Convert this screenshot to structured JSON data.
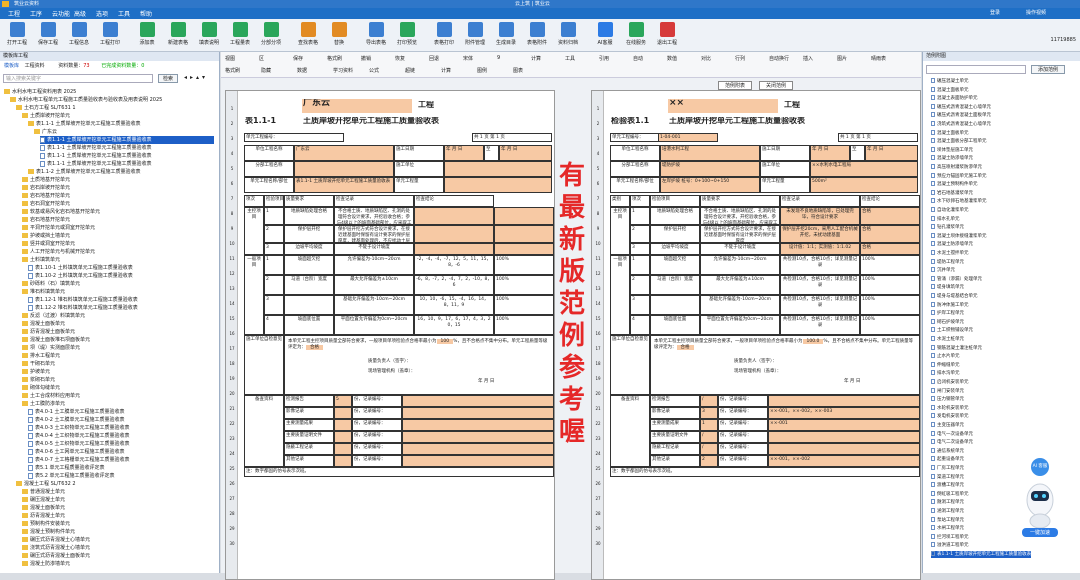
{
  "app": {
    "title": "筑业云资料",
    "center_title": "云上筑 | 筑业云",
    "menu": [
      "工程",
      "工序",
      "云功能",
      "高级",
      "选项",
      "工具",
      "帮助"
    ],
    "right_menu": [
      "登录",
      "操作视频"
    ]
  },
  "toolbar": {
    "buttons": [
      "打开工程",
      "保存工程",
      "工程信息",
      "工程打印",
      "添加表",
      "新建表格",
      "填表说明",
      "工程量表",
      "分部分项",
      "查找表格",
      "替换",
      "导出表格",
      "打印预览",
      "表格打印",
      "附件管理",
      "生成目录",
      "表格附件",
      "资料归档",
      "AI客服",
      "在线服务",
      "退出工程"
    ],
    "right_text": "11719885"
  },
  "left_panel": {
    "header": "模板库工程",
    "tabs": [
      "模板库",
      "工程资料"
    ],
    "count_label": "资料数量：",
    "count": "73",
    "done_label": "已完成资料数量：",
    "done": "0",
    "search_placeholder": "输入搜索关键字",
    "search_button": "检索",
    "tree": [
      {
        "t": "水利水电工程资料用表 2025",
        "d": 0,
        "f": "folder"
      },
      {
        "t": "水利水电工程单元工程施工质量验收表与验收表及用表说明 2025",
        "d": 1,
        "f": "folder"
      },
      {
        "t": "土石方工程 SL/T631 1",
        "d": 2,
        "f": "folder"
      },
      {
        "t": "土质岸坡开挖单元",
        "d": 3,
        "f": "folder"
      },
      {
        "t": "表1.1-1 土质岸坡开挖单元工程施工质量验收表",
        "d": 4,
        "f": "folder"
      },
      {
        "t": "广东云",
        "d": 5,
        "f": "folder"
      },
      {
        "t": "表1.1-1 土质岸坡开挖单元工程施工质量验收表",
        "d": 6,
        "f": "doc",
        "sel": true
      },
      {
        "t": "表1.1-1 土质岸坡开挖单元工程施工质量验收表",
        "d": 6,
        "f": "doc"
      },
      {
        "t": "表1.1-1 土质岸坡开挖单元工程施工质量验收表",
        "d": 6,
        "f": "doc"
      },
      {
        "t": "表1.1-1 土质岸坡开挖单元工程施工质量验收表",
        "d": 6,
        "f": "doc"
      },
      {
        "t": "表1.1-2 土质岸坡开挖单元工程施工质量验收表",
        "d": 4,
        "f": "folder"
      },
      {
        "t": "土质地基开挖单元",
        "d": 3,
        "f": "folder"
      },
      {
        "t": "岩石岸坡开挖单元",
        "d": 3,
        "f": "folder"
      },
      {
        "t": "岩石地基开挖单元",
        "d": 3,
        "f": "folder"
      },
      {
        "t": "岩石洞室开挖单元",
        "d": 3,
        "f": "folder"
      },
      {
        "t": "软基或易风化岩石地基开挖单元",
        "d": 3,
        "f": "folder"
      },
      {
        "t": "岩石地基开挖单元",
        "d": 3,
        "f": "folder"
      },
      {
        "t": "平洞开挖单元或洞室开挖单元",
        "d": 3,
        "f": "folder"
      },
      {
        "t": "护坡或挡土墙单元",
        "d": 3,
        "f": "folder"
      },
      {
        "t": "竖井或洞室开挖单元",
        "d": 3,
        "f": "folder"
      },
      {
        "t": "人工开挖单元与机械开挖单元",
        "d": 3,
        "f": "folder"
      },
      {
        "t": "土料填筑单元",
        "d": 3,
        "f": "folder"
      },
      {
        "t": "表1.10-1 土料填筑单元工程施工质量验收表",
        "d": 4,
        "f": "doc"
      },
      {
        "t": "表1.10-2 土料填筑单元工程施工质量验收表",
        "d": 4,
        "f": "doc"
      },
      {
        "t": "砂砾料（石）填筑单元",
        "d": 3,
        "f": "folder"
      },
      {
        "t": "堆石料填筑单元",
        "d": 3,
        "f": "folder"
      },
      {
        "t": "表1.12-1 堆石料填筑单元工程施工质量验收表",
        "d": 4,
        "f": "doc"
      },
      {
        "t": "表1.12-2 堆石料填筑单元工程施工质量验收表",
        "d": 4,
        "f": "doc"
      },
      {
        "t": "反滤（过渡）料填筑单元",
        "d": 3,
        "f": "folder"
      },
      {
        "t": "混凝土面板单元",
        "d": 3,
        "f": "folder"
      },
      {
        "t": "沥青混凝土面板单元",
        "d": 3,
        "f": "folder"
      },
      {
        "t": "混凝土面板堆石坝面板单元",
        "d": 3,
        "f": "folder"
      },
      {
        "t": "坝（堤）实测面层单元",
        "d": 3,
        "f": "folder"
      },
      {
        "t": "排水工程单元",
        "d": 3,
        "f": "folder"
      },
      {
        "t": "干砌石单元",
        "d": 3,
        "f": "folder"
      },
      {
        "t": "护坡单元",
        "d": 3,
        "f": "folder"
      },
      {
        "t": "浆砌石单元",
        "d": 3,
        "f": "folder"
      },
      {
        "t": "砌体勾缝单元",
        "d": 3,
        "f": "folder"
      },
      {
        "t": "土工合成材料应用单元",
        "d": 3,
        "f": "folder"
      },
      {
        "t": "土工膜防渗单元",
        "d": 3,
        "f": "folder"
      },
      {
        "t": "表4.0-1 土工膜单元工程施工质量验收表",
        "d": 4,
        "f": "doc"
      },
      {
        "t": "表4.0-2 土工膜单元工程施工质量验收表",
        "d": 4,
        "f": "doc"
      },
      {
        "t": "表4.0-3 土工织物单元工程施工质量验收表",
        "d": 4,
        "f": "doc"
      },
      {
        "t": "表4.0-4 土工织物单元工程施工质量验收表",
        "d": 4,
        "f": "doc"
      },
      {
        "t": "表4.0-5 土工织物单元工程施工质量验收表",
        "d": 4,
        "f": "doc"
      },
      {
        "t": "表4.0-6 土工网单元工程施工质量验收表",
        "d": 4,
        "f": "doc"
      },
      {
        "t": "表4.0-7 土工格栅单元工程施工质量验收表",
        "d": 4,
        "f": "doc"
      },
      {
        "t": "表5.1 单元工程质量验收评定表",
        "d": 4,
        "f": "doc"
      },
      {
        "t": "表5.2 单元工程施工质量验收评定表",
        "d": 4,
        "f": "doc"
      },
      {
        "t": "混凝土工程 SL/T632 2",
        "d": 2,
        "f": "folder"
      },
      {
        "t": "普通混凝土单元",
        "d": 3,
        "f": "folder"
      },
      {
        "t": "碾压混凝土单元",
        "d": 3,
        "f": "folder"
      },
      {
        "t": "混凝土面板单元",
        "d": 3,
        "f": "folder"
      },
      {
        "t": "沥青混凝土单元",
        "d": 3,
        "f": "folder"
      },
      {
        "t": "预制构件安装单元",
        "d": 3,
        "f": "folder"
      },
      {
        "t": "混凝土预制构件单元",
        "d": 3,
        "f": "folder"
      },
      {
        "t": "碾压式沥青混凝土心墙单元",
        "d": 3,
        "f": "folder"
      },
      {
        "t": "浇筑式沥青混凝土心墙单元",
        "d": 3,
        "f": "folder"
      },
      {
        "t": "碾压式沥青混凝土面板单元",
        "d": 3,
        "f": "folder"
      },
      {
        "t": "混凝土防渗墙单元",
        "d": 3,
        "f": "folder"
      }
    ]
  },
  "editor": {
    "toolbar_row1": [
      "视图",
      "区",
      "保存",
      "格式刷",
      "撤销",
      "恢复",
      "回退",
      "宋体",
      "9",
      "计算",
      "工具",
      "引用",
      "自动",
      "数值",
      "对比",
      "行列",
      "自动换行",
      "插入",
      "图片",
      "晴雨表"
    ],
    "toolbar_row2": [
      "格式刷",
      "隐藏",
      "数据",
      "学习资料",
      "公式",
      "超链",
      "计算",
      "图例",
      "图表"
    ],
    "view_tabs": [
      "范例附表",
      "关闭范例"
    ],
    "overlay": "有最新版范例参考喔"
  },
  "sheet_left": {
    "title_loc": "广东云",
    "title_suffix": "工程",
    "form_no": "表1.1-1",
    "form_title": "土质岸坡开挖单元工程施工质量验收表",
    "unit_no_label": "单元工程编号：",
    "page_label": "共 1 页 第 1 页",
    "rows": {
      "r1": [
        "单位工程名称",
        "广东云",
        "施工日期",
        "年 月 日",
        "至",
        "年 月 日"
      ],
      "r2": [
        "分部工程名称",
        "",
        "施工单位",
        ""
      ],
      "r3": [
        "单元工程名称/部位",
        "表1.1-1 土质岸坡开挖单元工程施工质量验收表",
        "单元工程量",
        ""
      ]
    },
    "headers": [
      "项次",
      "检验项目",
      "质量要求",
      "检查记录",
      "检查结论"
    ],
    "main_items": [
      {
        "no": "1",
        "item": "地质缺陷处理合格",
        "req": "不合格土质、地质缺陷区、孔洞的处理符合设计要求，开挖验收合格；参与4级以上的坡面基础部位，应采取工程措施处理",
        "rec": "",
        "res": ""
      },
      {
        "no": "2",
        "item": "保护层开挖",
        "req": "保护层开挖方式符合设计要求，在接近建基面时保留有设计要求的保护层厚度，建基面处理后，不应扰动土层",
        "rec": "",
        "res": ""
      },
      {
        "no": "3",
        "item": "边坡平均坡度",
        "req": "不陡于设计坡度",
        "rec": "",
        "res": ""
      }
    ],
    "general_items": [
      {
        "no": "1",
        "item": "坡面超欠挖",
        "req": "允许偏差为-10cm~20cm",
        "rec": "-2，-4，-4，-7，12，5，11，15，8，-6",
        "res": "100%"
      },
      {
        "no": "2",
        "item": "马道（台阶）宽度",
        "req": "最大允许偏差为±10cm",
        "rec": "-6，8，-7，2，-4，7，2，-10，8，6",
        "res": "100%"
      },
      {
        "no": "3",
        "item": "",
        "req": "基础允许偏差为-10cm~20cm",
        "rec": "10，10，-6，15，-4，16，14，8，11，9",
        "res": "100%"
      },
      {
        "no": "4",
        "item": "坡面底位置",
        "req": "平面位置允许偏差为0cm~20cm",
        "rec": "16，10，9，17，6，17，4，3，20，15",
        "res": "100%"
      }
    ],
    "group_main": "主控项目",
    "group_general": "一般项目",
    "eval_label": "施工单位自检意见",
    "eval_text": "本单元工程主控项目质量全部符合要求，一般项目单项检验点合格率最小为",
    "eval_pct": "100",
    "eval_suffix": "%，且不合格点不集中分布。单元工程质量等级评定为：",
    "eval_rate": "合格",
    "sign_qc": "质量负责人（签字）：",
    "sign_tech": "现场管理机构（盖章）：",
    "date": "年 月 日",
    "docs_label": "备查资料",
    "docs": [
      {
        "k": "检测报告",
        "n": "5",
        "u": "份，记录编号："
      },
      {
        "k": "影像记录",
        "n": "",
        "u": "份，记录编号："
      },
      {
        "k": "主要测量成果",
        "n": "",
        "u": "份，记录编号："
      },
      {
        "k": "主要质量证明文件",
        "n": "",
        "u": "份，记录编号："
      },
      {
        "k": "隐蔽工程记录",
        "n": "",
        "u": "份，记录编号："
      },
      {
        "k": "其他记录",
        "n": "",
        "u": "份，记录编号："
      }
    ],
    "note": "注：数字都固的仿号表示次班。"
  },
  "sheet_right": {
    "title_loc": "××",
    "title_suffix": "工程",
    "form_no": "检验表1.1",
    "form_title": "土质岸坡开挖单元工程施工质量验收表",
    "unit_no": "1-04-001",
    "page_label": "共 1 页 第 1 页",
    "rows": {
      "r1": [
        "单位工程名称",
        "培港水利工程",
        "施工日期",
        "年 月 日",
        "至",
        "年 月 日"
      ],
      "r2": [
        "分部工程名称",
        "堤防护坡",
        "施工单位",
        "××水利水电工程局"
      ],
      "r3": [
        "单元工程名称/部位",
        "左岸护坡 桩号：0+100~0+150",
        "单元工程量",
        "500m²"
      ]
    },
    "headers": [
      "类别",
      "项次",
      "检验项目",
      "质量要求",
      "检查记录",
      "检查结论"
    ],
    "main_items": [
      {
        "no": "1",
        "item": "地质缺陷处理合格",
        "req": "不合格土质、地质缺陷区、孔洞的处理符合设计要求，开挖验收合格，参与4级以上的坡面基础部位，应采取工程措施处理",
        "rec": "未发现不良地质缺陷等，已处理完毕，符合设计要求",
        "res": "合格"
      },
      {
        "no": "2",
        "item": "保护层开挖",
        "req": "保护层开挖方式符合设计要求，在接近建基面时保留有设计要求的保护层厚度",
        "rec": "保护层开挖20cm，采用人工配合机械开挖，未扰动建基面",
        "res": "合格"
      },
      {
        "no": "3",
        "item": "边坡平均坡度",
        "req": "不陡于设计坡度",
        "rec": "设计值：1:1；实测值：1:1.02",
        "res": "合格"
      }
    ],
    "general_items": [
      {
        "no": "1",
        "item": "坡面超欠挖",
        "req": "允许偏差为-10cm~20cm",
        "rec": "共检测10点，合格10点；详见测量记录",
        "res": "100%"
      },
      {
        "no": "2",
        "item": "马道（台阶）宽度",
        "req": "最大允许偏差为±10cm",
        "rec": "共检测10点，合格10点；详见测量记录",
        "res": "100%"
      },
      {
        "no": "3",
        "item": "",
        "req": "基础允许偏差为-10cm~20cm",
        "rec": "共检测10点，合格10点；详见测量记录",
        "res": "100%"
      },
      {
        "no": "4",
        "item": "坡面底位置",
        "req": "平面位置允许偏差为0cm~20cm",
        "rec": "共检测10点，合格10点；详见测量记录",
        "res": "100%"
      }
    ],
    "group_main": "主控项目",
    "group_general": "一般项目",
    "outer_group": "土质岸坡开挖",
    "eval_label": "施工单位自检意见",
    "eval_text": "本单元工程主控项目质量全部符合要求，一般项目单项检验点合格率最小为",
    "eval_pct": "100.0",
    "eval_suffix": "%，且不合格点不集中分布。单元工程质量等级评定为：",
    "eval_rate": "合格",
    "sign_qc": "质量负责人（签字）：",
    "sign_tech": "现场管理机构（盖章）：",
    "date": "年 月 日",
    "docs_label": "备查资料",
    "docs": [
      {
        "k": "检测报告",
        "n": "/",
        "u": "份，记录编号：",
        "code": ""
      },
      {
        "k": "影像记录",
        "n": "3",
        "u": "份，记录编号：",
        "code": "××-001，××-002，××-003"
      },
      {
        "k": "主要测量成果",
        "n": "1",
        "u": "份，记录编号：",
        "code": "××-001"
      },
      {
        "k": "主要质量证明文件",
        "n": "/",
        "u": "份，记录编号：",
        "code": ""
      },
      {
        "k": "隐蔽工程记录",
        "n": "/",
        "u": "份，记录编号：",
        "code": ""
      },
      {
        "k": "其他记录",
        "n": "2",
        "u": "份，记录编号：",
        "code": "××-001，××-002"
      }
    ],
    "note": "注：数字都固的仿号表示次班。"
  },
  "right_panel": {
    "header": "范例附图",
    "search_placeholder": "",
    "search_button": "添加范例",
    "robot_label": "一键加速",
    "robot_badge": "AI 客服",
    "items": [
      "碾压混凝土单元",
      "混凝土面板单元",
      "混凝土表面防护单元",
      "碾压式沥青混凝土心墙单元",
      "碾压式沥青混凝土面板单元",
      "浇筑式沥青混凝土心墙单元",
      "混凝土面板单元",
      "混凝土面板分部工程单元",
      "坝体垫层施工单元",
      "混凝土防渗墙单元",
      "高压喷射灌浆防渗单元",
      "预应力锚固单元施工单元",
      "混凝土预制构件单元",
      "岩石地基灌浆单元",
      "水下砂卵石地基灌浆单元",
      "自动化灌浆单元",
      "排水孔单元",
      "钻孔灌浆单元",
      "混凝土坝体接缝灌浆单元",
      "混凝土防渗墙单元",
      "水泥土搅拌单元",
      "堤防工程单元",
      "沉井单元",
      "管涌（渗漏）处理单元",
      "堤身填筑单元",
      "堤身与堤基结合单元",
      "防冲体施工单元",
      "护岸工程单元",
      "砌石护坡单元",
      "土工织物铺设单元",
      "水泥土桩单元",
      "钢筋混凝土灌注桩单元",
      "止水片单元",
      "伸缩缝单元",
      "排水沟单元",
      "启闭机安装单元",
      "闸门安装单元",
      "压力钢管单元",
      "水轮机安装单元",
      "发电机安装单元",
      "主变压器单元",
      "电气一次设备单元",
      "电气二次设备单元",
      "通信系统单元",
      "起重设备单元",
      "厂房工程单元",
      "渠道工程单元",
      "渡槽工程单元",
      "倒虹吸工程单元",
      "隧洞工程单元",
      "涵洞工程单元",
      "泵站工程单元",
      "水闸工程单元",
      "拦河坝工程单元",
      "溢洪道工程单元",
      "表1.1-1 土质岸坡开挖单元工程施工质量验收表"
    ]
  }
}
